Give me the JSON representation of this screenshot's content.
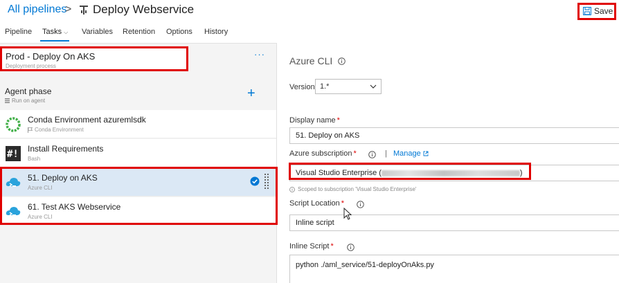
{
  "header": {
    "breadcrumb_root": "All pipelines",
    "breadcrumb_separator": ">",
    "pipeline_name": "Deploy Webservice",
    "save_label": "Save"
  },
  "tabs": [
    {
      "label": "Pipeline"
    },
    {
      "label": "Tasks",
      "active": true,
      "has_dropdown": true
    },
    {
      "label": "Variables"
    },
    {
      "label": "Retention"
    },
    {
      "label": "Options"
    },
    {
      "label": "History"
    }
  ],
  "stage": {
    "title": "Prod - Deploy On AKS",
    "subtitle": "Deployment process",
    "more_label": "···"
  },
  "agent_phase": {
    "title": "Agent phase",
    "subtitle": "Run on agent",
    "add_label": "+"
  },
  "tasks": [
    {
      "title": "Conda Environment azuremlsdk",
      "subtitle": "Conda Environment",
      "icon": "conda-icon"
    },
    {
      "title": "Install Requirements",
      "subtitle": "Bash",
      "icon": "bash-icon"
    },
    {
      "title": "51. Deploy on AKS",
      "subtitle": "Azure CLI",
      "icon": "azure-cli-icon",
      "selected": true
    },
    {
      "title": "61. Test AKS Webservice",
      "subtitle": "Azure CLI",
      "icon": "azure-cli-icon"
    }
  ],
  "detail": {
    "task_type": "Azure CLI",
    "version_label": "Version",
    "version_value": "1.*",
    "display_name_label": "Display name",
    "display_name_value": "51. Deploy on AKS",
    "subscription_label": "Azure subscription",
    "manage_label": "Manage",
    "subscription_value": "Visual Studio Enterprise (",
    "subscription_close": ")",
    "scoped_note": "Scoped to subscription 'Visual Studio Enterprise'",
    "script_location_label": "Script Location",
    "script_location_value": "Inline script",
    "inline_script_label": "Inline Script",
    "inline_script_value": "python ./aml_service/51-deployOnAks.py",
    "required_marker": "*"
  },
  "colors": {
    "accent": "#0078d4",
    "highlight_box": "#e00000",
    "selected_row": "#dbe8f5",
    "panel_bg": "#f4f4f4"
  }
}
